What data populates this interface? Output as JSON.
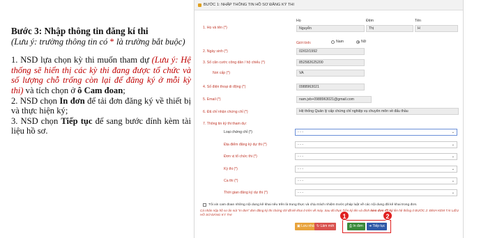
{
  "guide": {
    "title": "Bước 3: Nhập thông tin đăng kí thi",
    "subtitle_a": "(Lưu ý: trường thông tin có ",
    "subtitle_star": "*",
    "subtitle_b": " là trường bắt buộc)",
    "step1_a": "1.  NSD lựa chọn kỳ thi muốn tham dự ",
    "step1_note": "(Lưu ý: Hệ thống sẽ hiển thị các kỳ thi đang được tổ chức và số lượng chỗ trống còn lại để đăng ký ở mỗi kỳ thi)",
    "step1_b": " và tích chọn ở ",
    "step1_bold": "ô Cam đoan",
    "step1_c": ";",
    "step2_a": "2.  NSD chọn ",
    "step2_bold": "In đơn",
    "step2_b": " để tải đơn đăng ký về thiết bị và thực hiện ký;",
    "step3_a": "3.  NSD chọn ",
    "step3_bold": "Tiếp tục",
    "step3_b": " để sang bước đính kèm tài liệu hồ sơ."
  },
  "form": {
    "header": "BƯỚC 1: NHẬP THÔNG TIN HỒ SƠ ĐĂNG KÝ THI",
    "col_ho": "Họ",
    "col_dem": "Đệm",
    "col_ten": "Tên",
    "name_label": "1. Họ và tên (*)",
    "ho": "Nguyễn",
    "dem": "Thị",
    "ten": "H",
    "gender_label": "Giới tính:",
    "gender_male": "Nam",
    "gender_female": "Nữ",
    "dob_label": "2. Ngày sinh (*)",
    "dob": "02/02/1992",
    "id_label": "3. Số căn cước công dân / hộ chiếu (*)",
    "id_value": "852582625200",
    "issued_label": "Nơi cấp (*)",
    "issued_value": "VA",
    "phone_label": "4. Số điện thoại di động (*)",
    "phone": "0988963021",
    "email_label": "5. Email (*)",
    "email": "nam.jvb+0988963021@gmail.com",
    "cert_label": "6. Đã chỉ nhận chứng chỉ (*)",
    "cert_value": "Hệ thống Quản lý cấp chứng chỉ nghiệp vụ chuyên môn về đấu thầu",
    "exam_label": "7. Thông tin kỳ thi tham dự:",
    "exam_fields": [
      {
        "label": "Loại chứng chỉ (*)",
        "value": "- - -"
      },
      {
        "label": "Địa điểm đăng ký dự thi (*)",
        "value": "- - -"
      },
      {
        "label": "Đơn vị tổ chức thi (*)",
        "value": "- - -"
      },
      {
        "label": "Kỳ thi (*)",
        "value": "- - -"
      },
      {
        "label": "Ca thi (*)",
        "value": "- - -"
      },
      {
        "label": "Thời gian đăng ký dự thi (*)",
        "value": "- - -"
      }
    ],
    "pledge": "Tôi xin cam đoan những nội dung kê khai nêu trên là trung thực và chịu trách nhiệm trước pháp luật về các nội dung đã kê khai trong đơn.",
    "note_a": "Cá nhân nộp hồ sơ ấn nút \"In đơn\" đơn đăng ký thi chứng chỉ đã kê khai ở trên về máy. Sau đó thực hiện ký tên và đính ",
    "note_bold": "kèm đơn đã ký",
    "note_b": " lên hệ thống ở BƯỚC 2: ĐÍNH KÈM TÀI LIỆU HỒ SƠ ĐĂNG KÝ THI",
    "btn_draft": "Lưu nháp",
    "btn_redo": "Làm mới",
    "btn_print": "In đơn",
    "btn_next": "Tiếp tục",
    "badge1": "1",
    "badge2": "2"
  },
  "colors": {
    "required_red": "#c0392b",
    "highlight_red": "#e02020",
    "print_green": "#3a8a3a",
    "next_blue": "#2f5aa8",
    "draft_orange": "#e8a33c"
  }
}
